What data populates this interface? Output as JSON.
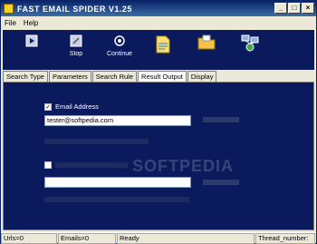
{
  "window": {
    "title": "FAST EMAIL SPIDER  V1.25"
  },
  "menu": {
    "items": [
      "File",
      "Help"
    ]
  },
  "toolbar": {
    "start_label": "",
    "stop_label": "Stop",
    "continue_label": "Continue",
    "open_label": "",
    "folder_label": "",
    "network_label": ""
  },
  "tabs": [
    "Search Type",
    "Parameters",
    "Search Rule",
    "Result Output",
    "Display"
  ],
  "result_output": {
    "email_checkbox_checked": true,
    "email_label": "Email Address",
    "email_value": "tester@softpedia.com",
    "second_checkbox_checked": false,
    "second_value": ""
  },
  "statusbar": {
    "urls": "Urls=0",
    "emails": "Emails=0",
    "state": "Ready",
    "thread": "Thread_number:"
  },
  "watermark": "SOFTPEDIA",
  "colors": {
    "panel": "#0b1a5c",
    "titlebar": "#0a246a"
  }
}
